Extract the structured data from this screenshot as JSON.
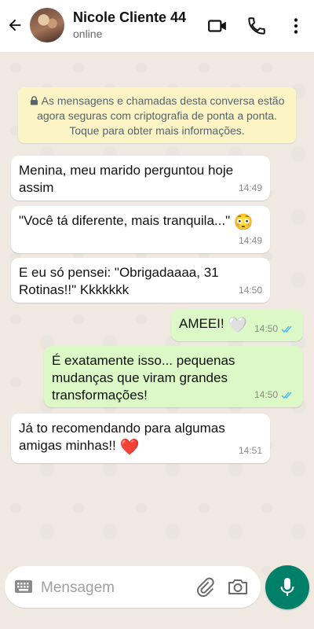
{
  "header": {
    "contact_name": "Nicole Cliente 44",
    "status": "online",
    "icons": [
      "back-arrow-icon",
      "avatar",
      "video-call-icon",
      "phone-icon",
      "more-options-icon"
    ]
  },
  "encryption_notice": {
    "text": "As mensagens e chamadas desta conversa estão agora seguras com criptografia de ponta a ponta. Toque para obter mais informações.",
    "icon": "lock-icon"
  },
  "messages": [
    {
      "direction": "incoming",
      "text": "Menina, meu marido perguntou hoje assim",
      "time": "14:49"
    },
    {
      "direction": "incoming",
      "text": "\"Você tá diferente, mais tranquila...\"",
      "emoji": "😳",
      "time": "14:49"
    },
    {
      "direction": "incoming",
      "text": "E eu só pensei: \"Obrigadaaaa, 31 Rotinas!!\" Kkkkkkk",
      "time": "14:50"
    },
    {
      "direction": "outgoing",
      "text": "AMEEI!",
      "emoji": "🤍",
      "time": "14:50",
      "status": "read"
    },
    {
      "direction": "outgoing",
      "text": "É exatamente isso... pequenas mudanças que viram grandes transformações!",
      "time": "14:50",
      "status": "read"
    },
    {
      "direction": "incoming",
      "text": "Já to recomendando para algumas amigas minhas!!",
      "emoji": "❤️",
      "time": "14:51"
    }
  ],
  "composer": {
    "placeholder": "Mensagem",
    "icons": [
      "keyboard-icon",
      "attach-icon",
      "camera-icon",
      "mic-icon"
    ]
  },
  "colors": {
    "incoming_bubble": "#ffffff",
    "outgoing_bubble": "#dcf8c6",
    "notice_bg": "#fdf4c5",
    "read_ticks": "#53bdeb",
    "mic_button": "#008069"
  }
}
